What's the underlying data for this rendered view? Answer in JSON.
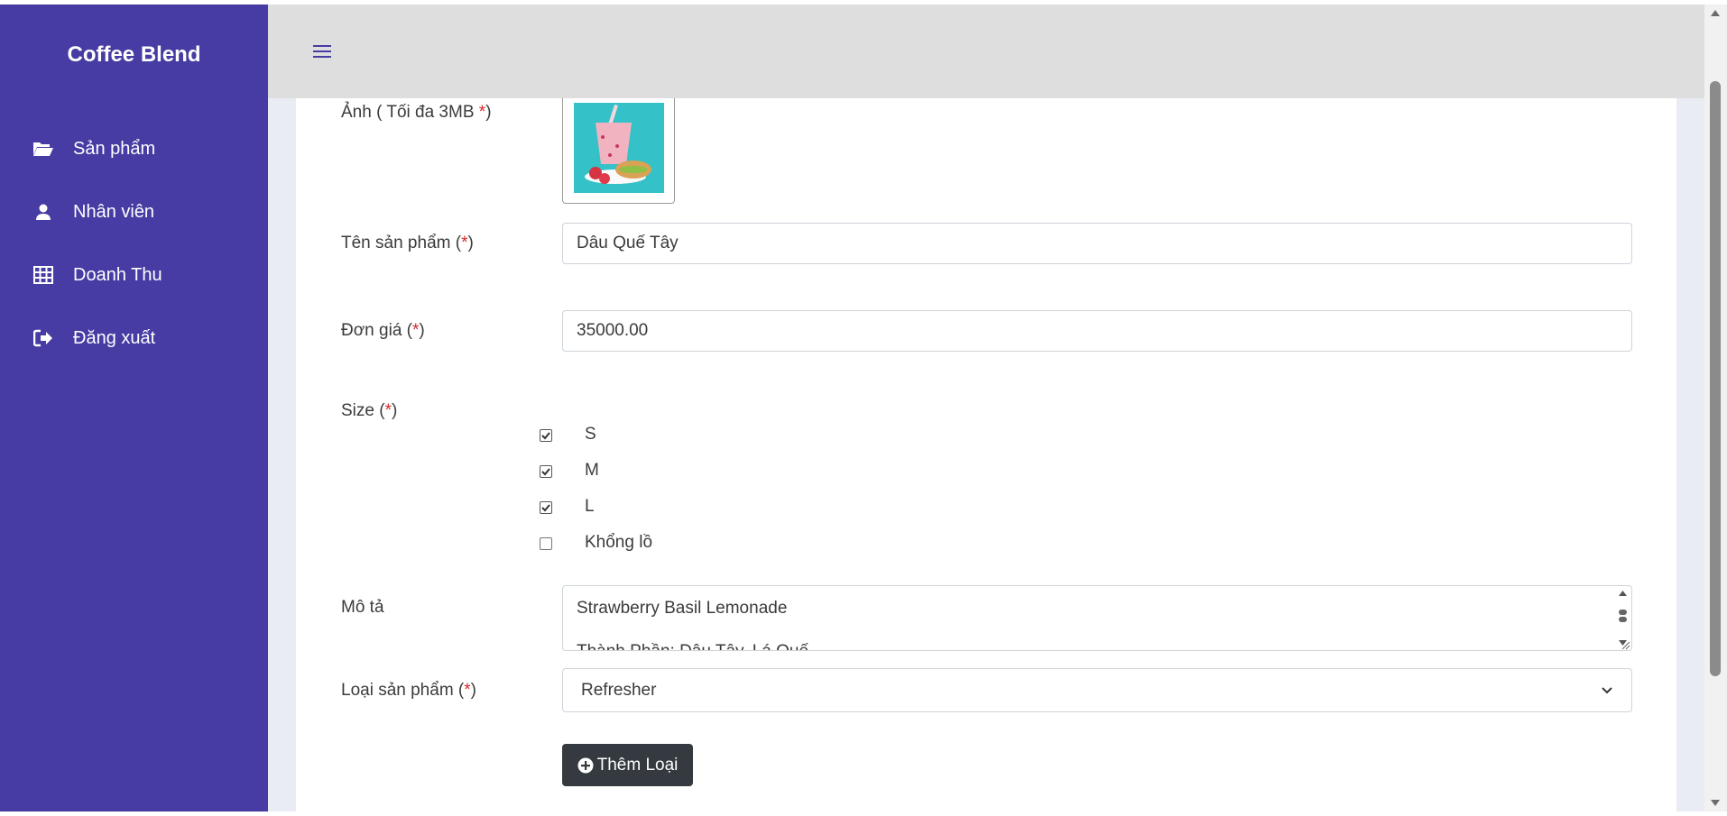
{
  "sidebar": {
    "brand": "Coffee Blend",
    "items": [
      {
        "label": "Sản phẩm",
        "icon": "folder-open-icon"
      },
      {
        "label": "Nhân viên",
        "icon": "user-icon"
      },
      {
        "label": "Doanh Thu",
        "icon": "table-icon"
      },
      {
        "label": "Đăng xuất",
        "icon": "sign-out-icon"
      }
    ]
  },
  "topbar": {
    "menu_icon": "hamburger-icon"
  },
  "form": {
    "image": {
      "label": "Ảnh ( Tối đa 3MB ",
      "req": "*",
      "close": ")"
    },
    "name": {
      "label": "Tên sản phẩm (",
      "req": "*",
      "close": ")",
      "value": "Dâu Quế Tây"
    },
    "price": {
      "label": "Đơn giá (",
      "req": "*",
      "close": ")",
      "value": "35000.00"
    },
    "size": {
      "label": "Size (",
      "req": "*",
      "close": ")",
      "options": [
        {
          "label": "S",
          "checked": true
        },
        {
          "label": "M",
          "checked": true
        },
        {
          "label": "L",
          "checked": true
        },
        {
          "label": "Khổng lồ",
          "checked": false
        }
      ]
    },
    "description": {
      "label": "Mô tả",
      "line1": "Strawberry Basil Lemonade",
      "line2": "Thành Phần: Dâu Tây, Lá Quế"
    },
    "category": {
      "label": "Loại sản phẩm (",
      "req": "*",
      "close": ")",
      "selected": "Refresher"
    },
    "add_category_button": "Thêm Loại"
  },
  "colors": {
    "sidebar": "#463ca3",
    "topbar": "#dedede",
    "button_dark": "#343a40",
    "required": "#d62828"
  }
}
